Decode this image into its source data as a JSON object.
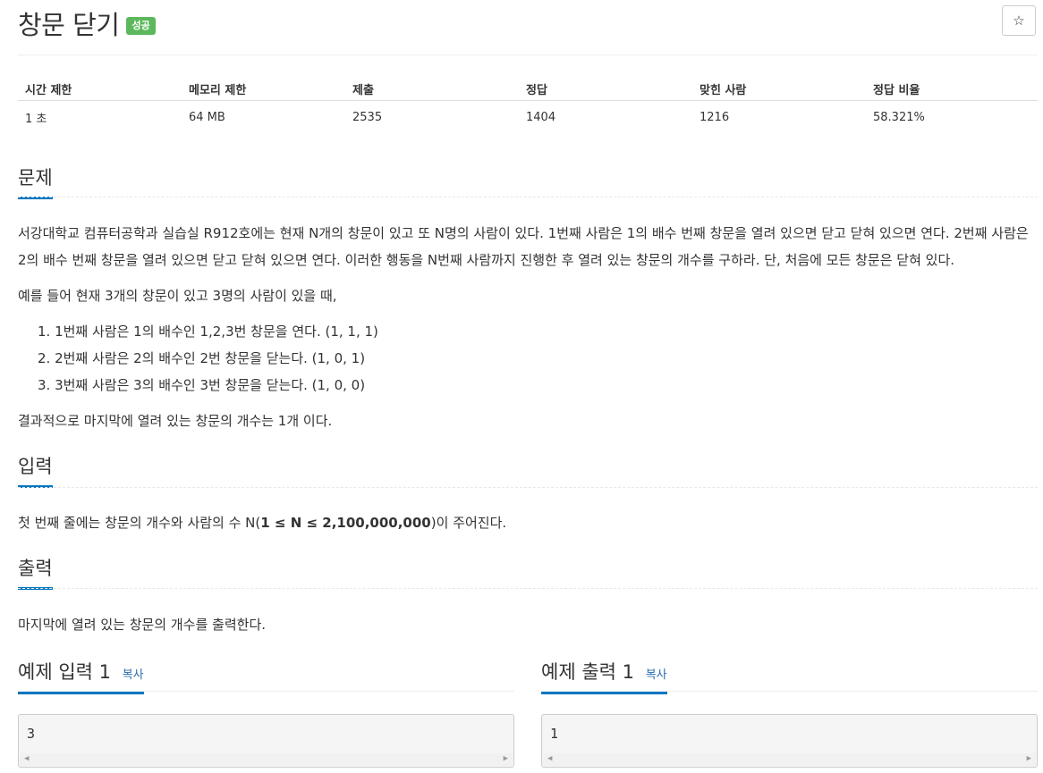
{
  "problem": {
    "title": "창문 닫기",
    "status_badge": "성공",
    "star_icon": "☆"
  },
  "info_table": {
    "headers": [
      "시간 제한",
      "메모리 제한",
      "제출",
      "정답",
      "맞힌 사람",
      "정답 비율"
    ],
    "values": [
      "1 초",
      "64 MB",
      "2535",
      "1404",
      "1216",
      "58.321%"
    ]
  },
  "description": {
    "heading": "문제",
    "paragraph1": "서강대학교 컴퓨터공학과 실습실 R912호에는 현재 N개의 창문이 있고 또 N명의 사람이 있다. 1번째 사람은 1의 배수 번째 창문을 열려 있으면 닫고 닫혀 있으면 연다.  2번째 사람은 2의 배수 번째 창문을 열려 있으면 닫고 닫혀 있으면 연다. 이러한 행동을 N번째 사람까지 진행한 후 열려 있는 창문의 개수를 구하라. 단, 처음에 모든 창문은 닫혀 있다.",
    "paragraph2": "예를 들어 현재 3개의 창문이 있고 3명의 사람이 있을 때,",
    "steps": [
      "1. 1번째 사람은 1의 배수인 1,2,3번 창문을 연다. (1, 1, 1)",
      "2. 2번째 사람은 2의 배수인 2번 창문을 닫는다. (1, 0, 1)",
      "3. 3번째 사람은 3의 배수인 3번 창문을 닫는다. (1, 0, 0)"
    ],
    "paragraph3": "결과적으로 마지막에 열려 있는 창문의 개수는 1개 이다."
  },
  "input": {
    "heading": "입력",
    "text_before": "첫 번째 줄에는 창문의 개수와 사람의 수 N(",
    "text_bold": "1 ≤ N ≤ 2,100,000,000",
    "text_after": ")이 주어진다."
  },
  "output": {
    "heading": "출력",
    "text": "마지막에 열려 있는 창문의 개수를 출력한다."
  },
  "examples": {
    "input_title": "예제 입력 1",
    "output_title": "예제 출력 1",
    "copy_label": "복사",
    "input_value": "3",
    "output_value": "1",
    "arrow_left": "◀",
    "arrow_right": "▶"
  }
}
